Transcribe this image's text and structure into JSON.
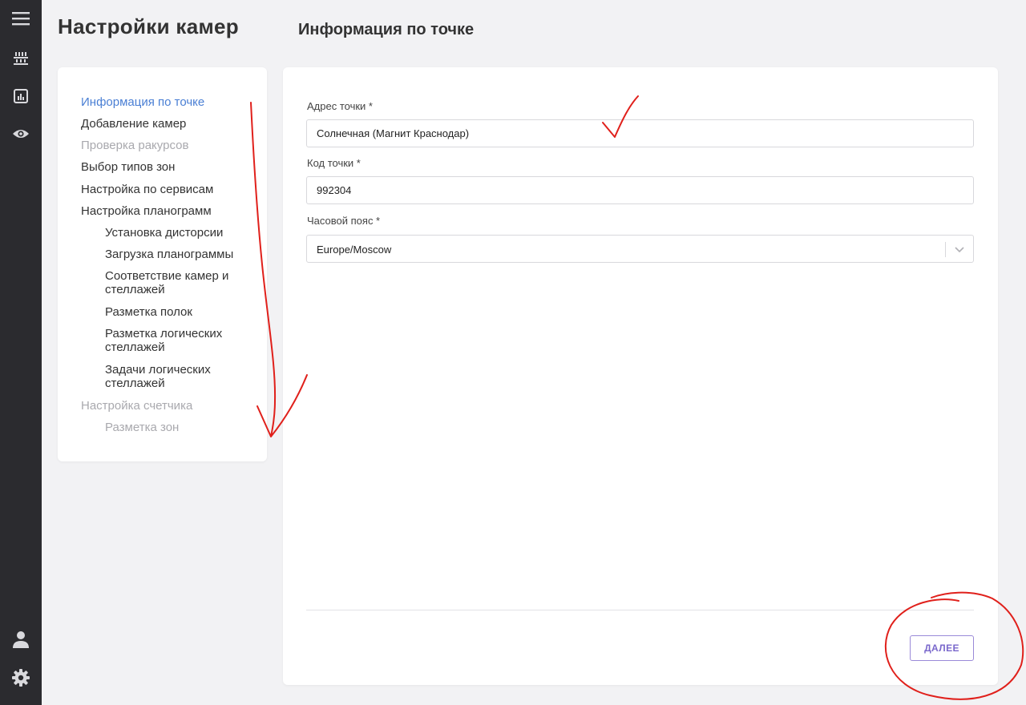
{
  "header": {
    "page_title": "Настройки камер",
    "section_title": "Информация по точке"
  },
  "sidebar_icons": [
    "menu-icon",
    "shelves-icon",
    "chart-icon",
    "eye-icon",
    "user-icon",
    "gear-icon"
  ],
  "steps": [
    {
      "label": "Информация по точке",
      "state": "active"
    },
    {
      "label": "Добавление камер",
      "state": "normal"
    },
    {
      "label": "Проверка ракурсов",
      "state": "disabled"
    },
    {
      "label": "Выбор типов зон",
      "state": "normal"
    },
    {
      "label": "Настройка по сервисам",
      "state": "normal"
    },
    {
      "label": "Настройка планограмм",
      "state": "normal"
    },
    {
      "label": "Установка дисторсии",
      "state": "normal"
    },
    {
      "label": "Загрузка планограммы",
      "state": "normal"
    },
    {
      "label": "Соответствие камер и стеллажей",
      "state": "normal"
    },
    {
      "label": "Разметка полок",
      "state": "normal"
    },
    {
      "label": "Разметка логических стеллажей",
      "state": "normal"
    },
    {
      "label": "Задачи логических стеллажей",
      "state": "normal"
    },
    {
      "label": "Настройка счетчика",
      "state": "disabled"
    },
    {
      "label": "Разметка зон",
      "state": "disabled"
    }
  ],
  "form": {
    "address": {
      "label": "Адрес точки *",
      "value": "Солнечная (Магнит Краснодар)"
    },
    "code": {
      "label": "Код точки *",
      "value": "992304"
    },
    "timezone": {
      "label": "Часовой пояс *",
      "value": "Europe/Moscow"
    }
  },
  "footer": {
    "next_label": "ДАЛЕЕ"
  },
  "colors": {
    "rail": "#2b2b2f",
    "active_step": "#4a7fd4",
    "disabled_step": "#a9a9ae",
    "button_accent": "#7a68cc",
    "annotation": "#e0201b"
  }
}
